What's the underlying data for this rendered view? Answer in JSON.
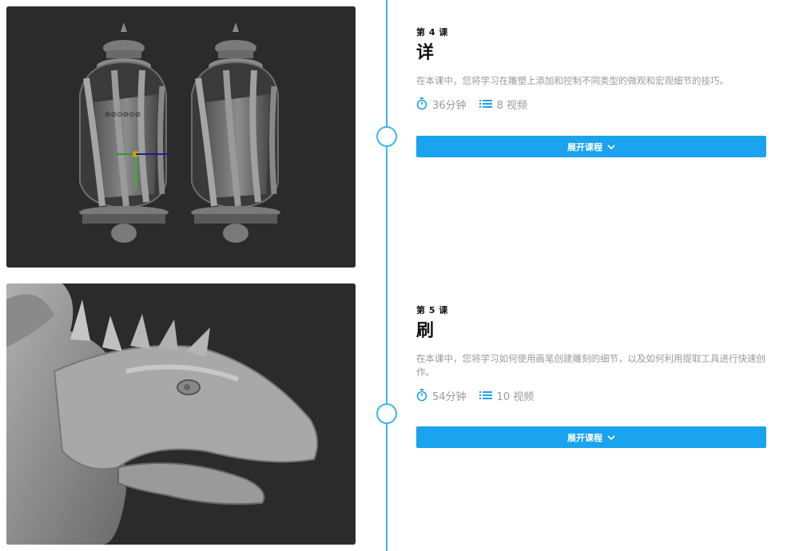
{
  "lessons": [
    {
      "number": "第 4 课",
      "title": "详",
      "description": "在本课中，您将学习在雕塑上添加和控制不同类型的微观和宏观细节的技巧。",
      "duration": "36分钟",
      "videos": "8 视频",
      "expand_label": "展开课程",
      "image_alt": "lantern sculpt"
    },
    {
      "number": "第 5 课",
      "title": "刷",
      "description": "在本课中，您将学习如何使用画笔创建雕刻的细节，以及如何利用提取工具进行快速创作。",
      "duration": "54分钟",
      "videos": "10 视频",
      "expand_label": "展开课程",
      "image_alt": "dragon sculpt"
    }
  ],
  "colors": {
    "accent": "#1aa3ee",
    "timeline": "#3fb6ee",
    "thumb_bg": "#2b2b2b"
  },
  "icons": {
    "duration": "stopwatch-icon",
    "videos": "list-icon",
    "expand": "chevron-down-icon"
  }
}
